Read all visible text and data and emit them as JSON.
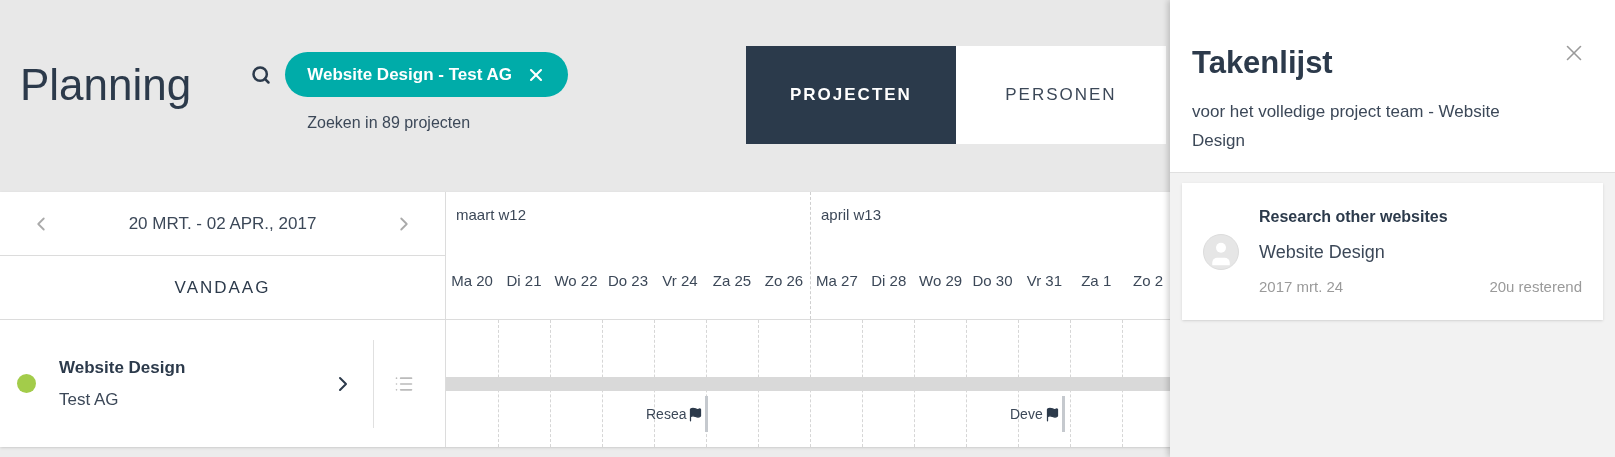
{
  "header": {
    "title": "Planning",
    "search_chip": "Website Design - Test AG",
    "search_hint": "Zoeken in 89 projecten"
  },
  "view_tabs": [
    {
      "label": "PROJECTEN",
      "selected": true
    },
    {
      "label": "PERSONEN",
      "selected": false
    }
  ],
  "date_nav": {
    "range": "20 MRT. - 02 APR., 2017",
    "today": "VANDAAG"
  },
  "weeks": [
    {
      "label": "maart w12",
      "days": [
        {
          "label": "Ma 20"
        },
        {
          "label": "Di 21"
        },
        {
          "label": "Wo 22"
        },
        {
          "label": "Do 23"
        },
        {
          "label": "Vr 24",
          "milestone": "Resea"
        },
        {
          "label": "Za 25"
        },
        {
          "label": "Zo 26"
        }
      ]
    },
    {
      "label": "april w13",
      "days": [
        {
          "label": "Ma 27"
        },
        {
          "label": "Di 28"
        },
        {
          "label": "Wo 29"
        },
        {
          "label": "Do 30"
        },
        {
          "label": "Vr 31",
          "milestone": "Deve"
        },
        {
          "label": "Za 1"
        },
        {
          "label": "Zo 2"
        }
      ]
    }
  ],
  "projects": [
    {
      "name": "Website Design",
      "client": "Test AG",
      "color": "#a3cc4a"
    }
  ],
  "task_panel": {
    "title": "Takenlijst",
    "subtitle": "voor het volledige project team - Website Design",
    "tasks": [
      {
        "title": "Research other websites",
        "project": "Website Design",
        "date": "2017 mrt. 24",
        "remaining": "20u resterend"
      }
    ]
  }
}
